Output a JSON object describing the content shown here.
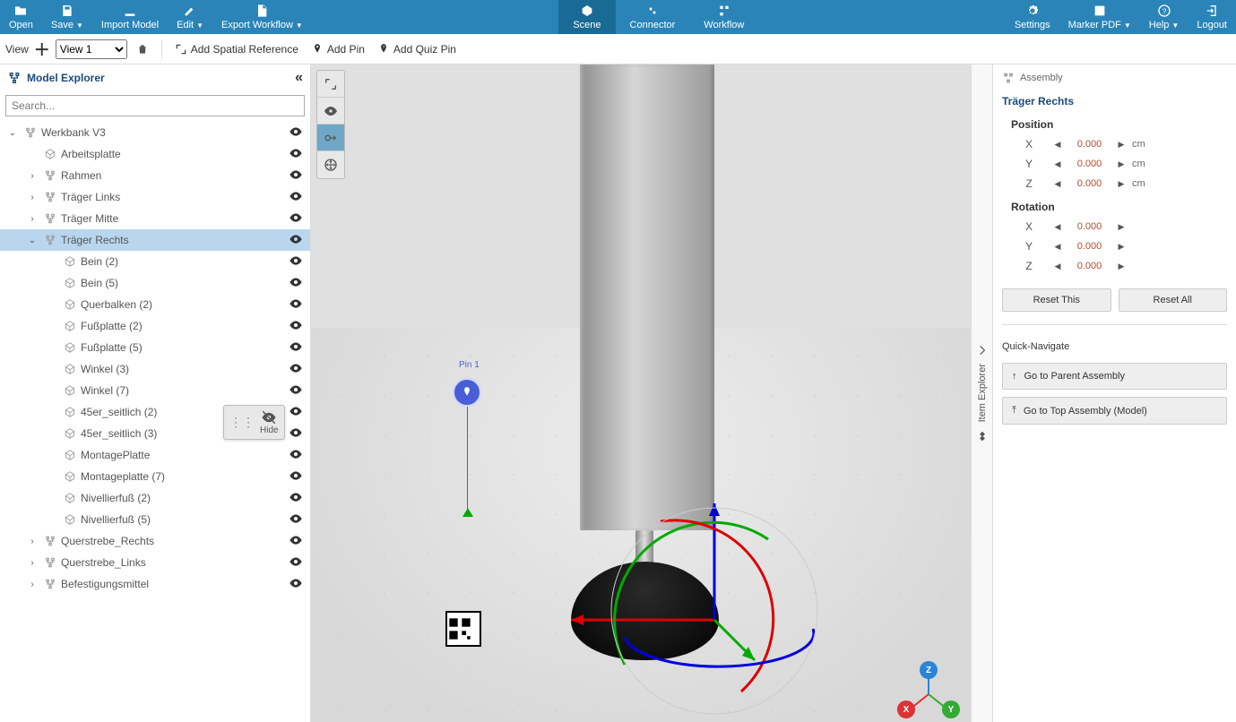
{
  "toolbar": {
    "open": "Open",
    "save": "Save",
    "import_model": "Import Model",
    "edit": "Edit",
    "export_workflow": "Export Workflow",
    "settings": "Settings",
    "marker_pdf": "Marker PDF",
    "help": "Help",
    "logout": "Logout"
  },
  "nav": {
    "scene": "Scene",
    "connector": "Connector",
    "workflow": "Workflow",
    "active": "scene"
  },
  "subbar": {
    "view_label": "View",
    "view_value": "View 1",
    "add_spatial": "Add Spatial Reference",
    "add_pin": "Add Pin",
    "add_quiz_pin": "Add Quiz Pin"
  },
  "explorer": {
    "title": "Model Explorer",
    "search_placeholder": "Search...",
    "hide_label": "Hide",
    "tree": [
      {
        "depth": 0,
        "toggle": "down",
        "icon": "assembly",
        "label": "Werkbank V3",
        "vis": true
      },
      {
        "depth": 1,
        "toggle": "",
        "icon": "part",
        "label": "Arbeitsplatte",
        "vis": true
      },
      {
        "depth": 1,
        "toggle": "right",
        "icon": "assembly",
        "label": "Rahmen",
        "vis": true
      },
      {
        "depth": 1,
        "toggle": "right",
        "icon": "assembly",
        "label": "Träger Links",
        "vis": true
      },
      {
        "depth": 1,
        "toggle": "right",
        "icon": "assembly",
        "label": "Träger Mitte",
        "vis": true
      },
      {
        "depth": 1,
        "toggle": "down",
        "icon": "assembly",
        "label": "Träger Rechts",
        "vis": true,
        "selected": true
      },
      {
        "depth": 2,
        "toggle": "",
        "icon": "part",
        "label": "Bein (2)",
        "vis": true
      },
      {
        "depth": 2,
        "toggle": "",
        "icon": "part",
        "label": "Bein (5)",
        "vis": true
      },
      {
        "depth": 2,
        "toggle": "",
        "icon": "part",
        "label": "Querbalken (2)",
        "vis": true
      },
      {
        "depth": 2,
        "toggle": "",
        "icon": "part",
        "label": "Fußplatte (2)",
        "vis": true
      },
      {
        "depth": 2,
        "toggle": "",
        "icon": "part",
        "label": "Fußplatte (5)",
        "vis": true
      },
      {
        "depth": 2,
        "toggle": "",
        "icon": "part",
        "label": "Winkel (3)",
        "vis": true
      },
      {
        "depth": 2,
        "toggle": "",
        "icon": "part",
        "label": "Winkel (7)",
        "vis": true
      },
      {
        "depth": 2,
        "toggle": "",
        "icon": "part",
        "label": "45er_seitlich (2)",
        "vis": true
      },
      {
        "depth": 2,
        "toggle": "",
        "icon": "part",
        "label": "45er_seitlich (3)",
        "vis": true
      },
      {
        "depth": 2,
        "toggle": "",
        "icon": "part",
        "label": "MontagePlatte",
        "vis": true
      },
      {
        "depth": 2,
        "toggle": "",
        "icon": "part",
        "label": "Montageplatte (7)",
        "vis": true
      },
      {
        "depth": 2,
        "toggle": "",
        "icon": "part",
        "label": "Nivellierfuß (2)",
        "vis": true
      },
      {
        "depth": 2,
        "toggle": "",
        "icon": "part",
        "label": "Nivellierfuß (5)",
        "vis": true
      },
      {
        "depth": 1,
        "toggle": "right",
        "icon": "assembly",
        "label": "Querstrebe_Rechts",
        "vis": true
      },
      {
        "depth": 1,
        "toggle": "right",
        "icon": "assembly",
        "label": "Querstrebe_Links",
        "vis": true
      },
      {
        "depth": 1,
        "toggle": "right",
        "icon": "assembly",
        "label": "Befestigungsmittel",
        "vis": true
      }
    ]
  },
  "viewport": {
    "pin_label": "Pin 1",
    "tools": [
      "expand",
      "eye",
      "link",
      "move"
    ]
  },
  "item_explorer_label": "Item Explorer",
  "right": {
    "breadcrumb_icon": "assembly",
    "breadcrumb": "Assembly",
    "title": "Träger Rechts",
    "position_label": "Position",
    "rotation_label": "Rotation",
    "unit": "cm",
    "position": {
      "X": "0.000",
      "Y": "0.000",
      "Z": "0.000"
    },
    "rotation": {
      "X": "0.000",
      "Y": "0.000",
      "Z": "0.000"
    },
    "reset_this": "Reset This",
    "reset_all": "Reset All",
    "quick_nav": "Quick-Navigate",
    "go_parent": "Go to Parent Assembly",
    "go_top": "Go to Top Assembly (Model)"
  }
}
